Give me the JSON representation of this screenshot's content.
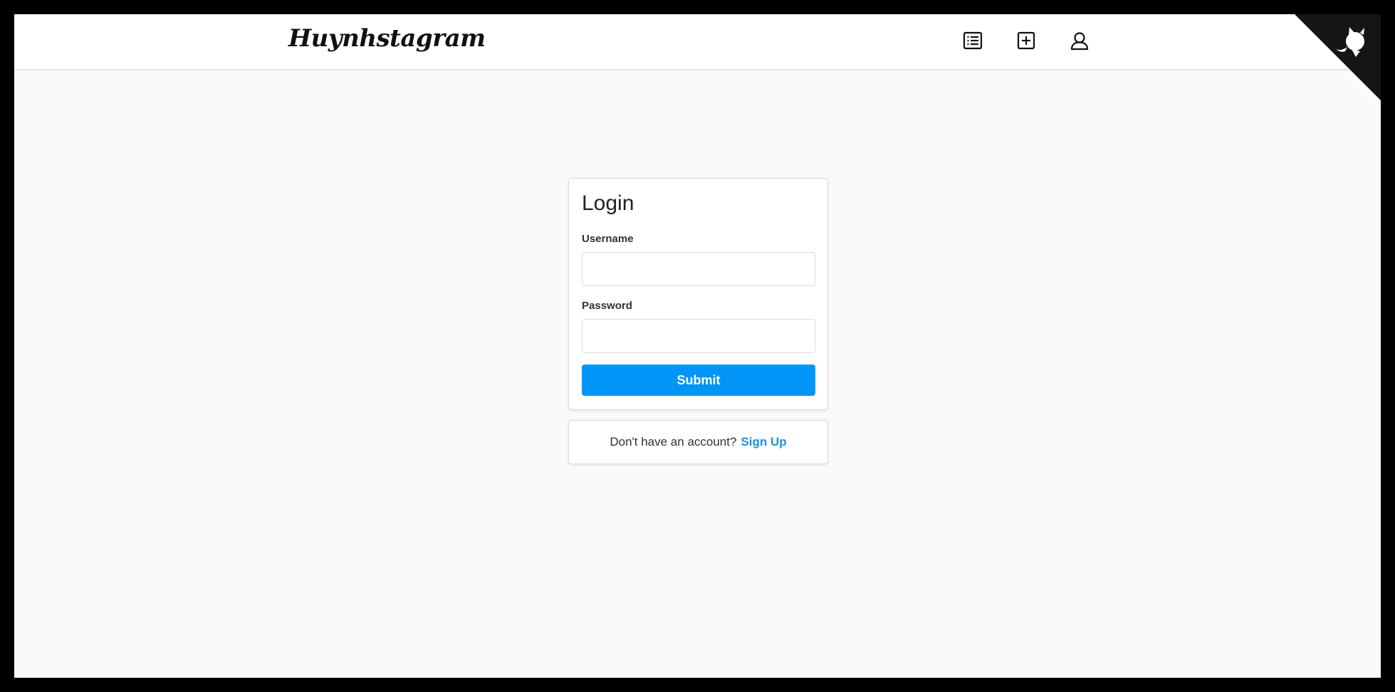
{
  "navbar": {
    "brand": "Huynhstagram",
    "icons": [
      "feed-list-icon",
      "add-post-icon",
      "profile-icon"
    ]
  },
  "corner": {
    "icon": "github-octocat-icon",
    "color": "#151513"
  },
  "login": {
    "title": "Login",
    "username_label": "Username",
    "username_value": "",
    "password_label": "Password",
    "password_value": "",
    "submit_label": "Submit"
  },
  "signup": {
    "prompt": "Don't have an account?",
    "link_label": "Sign Up"
  },
  "colors": {
    "accent": "#0095f6",
    "link": "#1f8fd8",
    "background": "#fafafa",
    "frame": "#000000"
  }
}
